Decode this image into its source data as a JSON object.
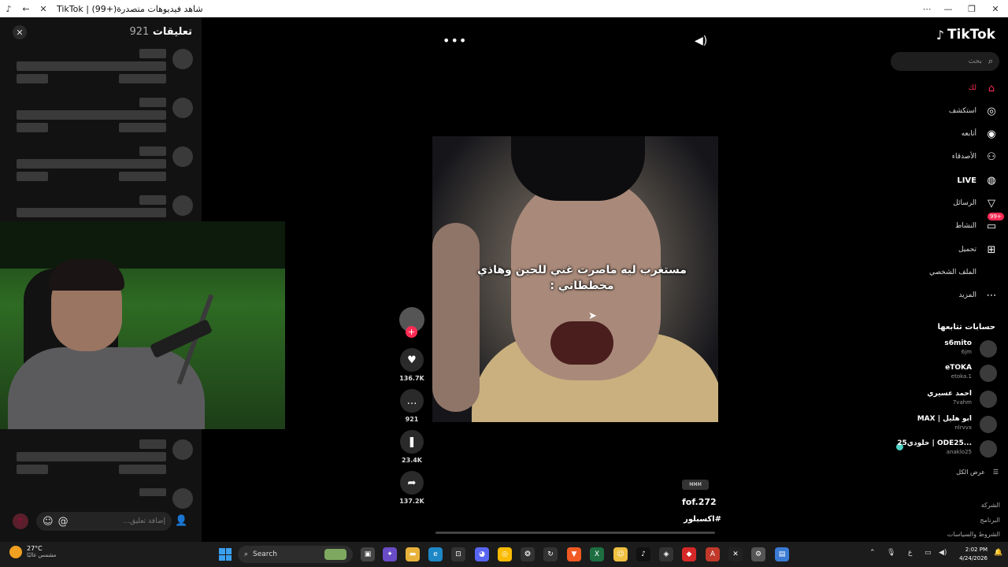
{
  "window": {
    "title": "TikTok | شاهد فيديوهات متصدرة(+99)",
    "back_icon": "arrow-left-icon",
    "stop_icon": "close-icon",
    "controls": [
      "more",
      "minimize",
      "restore",
      "close"
    ]
  },
  "comments": {
    "title": "تعليقات",
    "count": "921",
    "input_placeholder": "إضافة تعليق...",
    "mention_symbol": "@",
    "send_icon": "arrow-up-icon"
  },
  "video": {
    "caption": "مستغرب ليه ماصرت غني للحين وهاذي مخططاتي :",
    "badge": "MMM",
    "author": "fof.272",
    "hashtag": "#اكسبلور",
    "progress": 0.0
  },
  "actions": {
    "likes": "136.7K",
    "comments": "921",
    "saves": "23.4K",
    "shares": "137.2K",
    "follow_plus": "+"
  },
  "sidebar": {
    "logo": "TikTok",
    "search_placeholder": "بحث",
    "nav": [
      {
        "label": "لك",
        "icon": "home-icon"
      },
      {
        "label": "استكشف",
        "icon": "compass-icon"
      },
      {
        "label": "أتابعه",
        "icon": "following-avatar-icon"
      },
      {
        "label": "الأصدقاء",
        "icon": "friends-icon"
      },
      {
        "label": "LIVE",
        "icon": "live-avatar-icon"
      },
      {
        "label": "الرسائل",
        "icon": "send-icon"
      },
      {
        "label": "النشاط",
        "icon": "inbox-icon",
        "badge": "99+"
      },
      {
        "label": "تحميل",
        "icon": "upload-plus-icon"
      },
      {
        "label": "الملف الشخصي",
        "icon": "profile-icon"
      },
      {
        "label": "المزيد",
        "icon": "more-icon"
      }
    ],
    "following_title": "حسابات تتابعها",
    "following": [
      {
        "name": "s6mito",
        "handle": "6jm"
      },
      {
        "name": "eTOKA",
        "handle": "etoka.1"
      },
      {
        "name": "احمد عسيري",
        "handle": "7vahm"
      },
      {
        "name": "MAX | ابو هليل",
        "handle": "nlrvvx"
      },
      {
        "name": "خلودي25 | ODE25...",
        "handle": "anaklo25"
      }
    ],
    "see_all": "عرض الكل",
    "footer": [
      "الشركة",
      "البرنامج",
      "الشروط والسياسات"
    ]
  },
  "taskbar": {
    "temperature": "27°C",
    "weather_desc": "مشمس غالبًا",
    "weather_badge": "1",
    "search_label": "Search",
    "lang": "ع",
    "time": "2:02 PM",
    "date": "4/24/2026",
    "notif_badges": [
      "99+",
      "99+"
    ]
  }
}
